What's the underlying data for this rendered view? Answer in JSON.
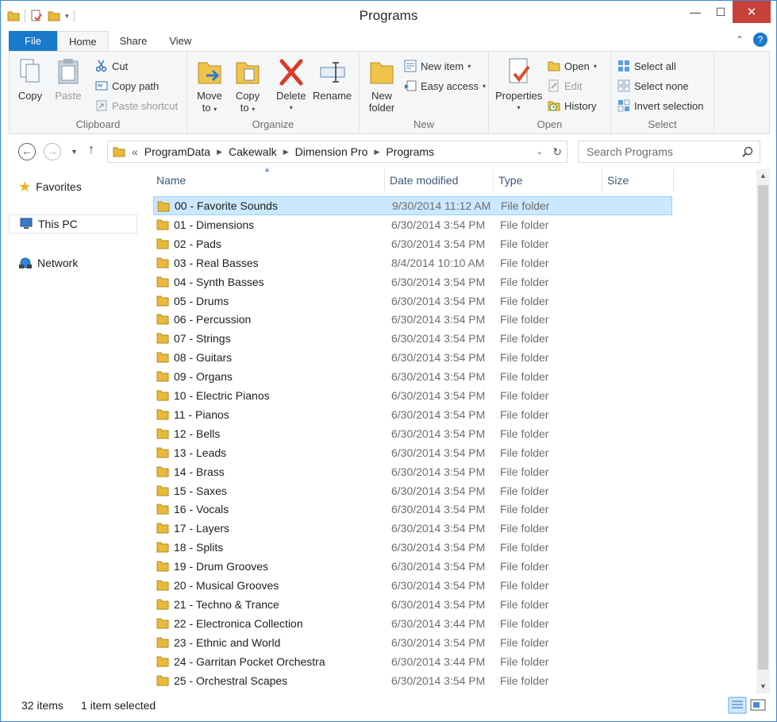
{
  "window": {
    "title": "Programs"
  },
  "titlebar_controls": {
    "minimize": "—",
    "maximize": "☐",
    "close": "✕"
  },
  "tabs": [
    {
      "label": "File"
    },
    {
      "label": "Home"
    },
    {
      "label": "Share"
    },
    {
      "label": "View"
    }
  ],
  "ribbon": {
    "clipboard": {
      "label": "Clipboard",
      "copy": "Copy",
      "paste": "Paste",
      "cut": "Cut",
      "copy_path": "Copy path",
      "paste_shortcut": "Paste shortcut"
    },
    "organize": {
      "label": "Organize",
      "move_to": "Move",
      "move_to_2": "to",
      "copy_to": "Copy",
      "copy_to_2": "to",
      "delete": "Delete",
      "rename": "Rename"
    },
    "new": {
      "label": "New",
      "new_folder": "New",
      "new_folder_2": "folder",
      "new_item": "New item",
      "easy_access": "Easy access"
    },
    "open": {
      "label": "Open",
      "properties": "Properties",
      "open": "Open",
      "edit": "Edit",
      "history": "History"
    },
    "select": {
      "label": "Select",
      "select_all": "Select all",
      "select_none": "Select none",
      "invert": "Invert selection"
    }
  },
  "address": {
    "overflow": "«",
    "crumbs": [
      "ProgramData",
      "Cakewalk",
      "Dimension Pro",
      "Programs"
    ],
    "search_placeholder": "Search Programs"
  },
  "nav": {
    "favorites": "Favorites",
    "this_pc": "This PC",
    "network": "Network"
  },
  "columns": {
    "name": "Name",
    "date": "Date modified",
    "type": "Type",
    "size": "Size"
  },
  "files": [
    {
      "name": "00 - Favorite Sounds",
      "date": "9/30/2014 11:12 AM",
      "type": "File folder"
    },
    {
      "name": "01 - Dimensions",
      "date": "6/30/2014 3:54 PM",
      "type": "File folder"
    },
    {
      "name": "02 - Pads",
      "date": "6/30/2014 3:54 PM",
      "type": "File folder"
    },
    {
      "name": "03 - Real Basses",
      "date": "8/4/2014 10:10 AM",
      "type": "File folder"
    },
    {
      "name": "04 - Synth Basses",
      "date": "6/30/2014 3:54 PM",
      "type": "File folder"
    },
    {
      "name": "05 - Drums",
      "date": "6/30/2014 3:54 PM",
      "type": "File folder"
    },
    {
      "name": "06 - Percussion",
      "date": "6/30/2014 3:54 PM",
      "type": "File folder"
    },
    {
      "name": "07 - Strings",
      "date": "6/30/2014 3:54 PM",
      "type": "File folder"
    },
    {
      "name": "08 - Guitars",
      "date": "6/30/2014 3:54 PM",
      "type": "File folder"
    },
    {
      "name": "09 - Organs",
      "date": "6/30/2014 3:54 PM",
      "type": "File folder"
    },
    {
      "name": "10 - Electric Pianos",
      "date": "6/30/2014 3:54 PM",
      "type": "File folder"
    },
    {
      "name": "11 - Pianos",
      "date": "6/30/2014 3:54 PM",
      "type": "File folder"
    },
    {
      "name": "12 - Bells",
      "date": "6/30/2014 3:54 PM",
      "type": "File folder"
    },
    {
      "name": "13 - Leads",
      "date": "6/30/2014 3:54 PM",
      "type": "File folder"
    },
    {
      "name": "14 - Brass",
      "date": "6/30/2014 3:54 PM",
      "type": "File folder"
    },
    {
      "name": "15 - Saxes",
      "date": "6/30/2014 3:54 PM",
      "type": "File folder"
    },
    {
      "name": "16 - Vocals",
      "date": "6/30/2014 3:54 PM",
      "type": "File folder"
    },
    {
      "name": "17 - Layers",
      "date": "6/30/2014 3:54 PM",
      "type": "File folder"
    },
    {
      "name": "18 - Splits",
      "date": "6/30/2014 3:54 PM",
      "type": "File folder"
    },
    {
      "name": "19 - Drum Grooves",
      "date": "6/30/2014 3:54 PM",
      "type": "File folder"
    },
    {
      "name": "20 - Musical Grooves",
      "date": "6/30/2014 3:54 PM",
      "type": "File folder"
    },
    {
      "name": "21 - Techno & Trance",
      "date": "6/30/2014 3:54 PM",
      "type": "File folder"
    },
    {
      "name": "22 - Electronica Collection",
      "date": "6/30/2014 3:44 PM",
      "type": "File folder"
    },
    {
      "name": "23 - Ethnic and World",
      "date": "6/30/2014 3:54 PM",
      "type": "File folder"
    },
    {
      "name": "24 - Garritan Pocket Orchestra",
      "date": "6/30/2014 3:44 PM",
      "type": "File folder"
    },
    {
      "name": "25 - Orchestral Scapes",
      "date": "6/30/2014 3:54 PM",
      "type": "File folder"
    }
  ],
  "status": {
    "count": "32 items",
    "selected": "1 item selected"
  },
  "colors": {
    "accent": "#1979ca",
    "selection": "#cce8ff",
    "close": "#c7413a",
    "folder": "#e8b93b"
  }
}
